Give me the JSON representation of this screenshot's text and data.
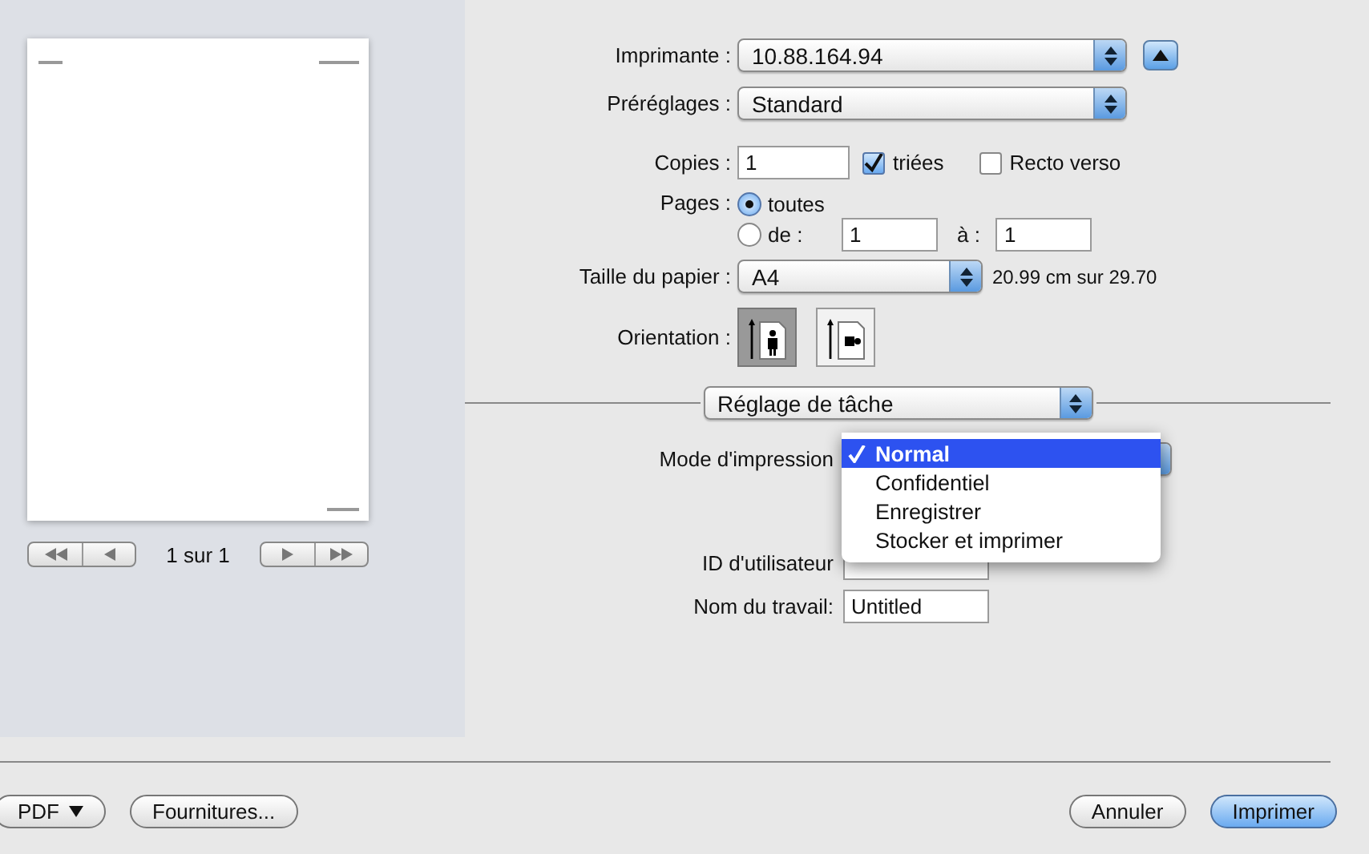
{
  "preview": {
    "page_counter": "1 sur 1"
  },
  "printer": {
    "label": "Imprimante :",
    "value": "10.88.164.94"
  },
  "presets": {
    "label": "Préréglages :",
    "value": "Standard"
  },
  "copies": {
    "label": "Copies :",
    "value": "1"
  },
  "collated": {
    "label": "triées",
    "checked": true
  },
  "duplex": {
    "label": "Recto verso",
    "checked": false
  },
  "pages": {
    "label": "Pages :",
    "options": [
      {
        "label": "toutes",
        "selected": true
      },
      {
        "label": "de :",
        "selected": false
      }
    ],
    "from": "1",
    "to_label": "à :",
    "to": "1"
  },
  "paper": {
    "label": "Taille du papier :",
    "value": "A4",
    "dimensions": "20.99 cm sur 29.70"
  },
  "orientation": {
    "label": "Orientation :",
    "options": [
      {
        "kind": "portrait",
        "selected": true
      },
      {
        "kind": "landscape",
        "selected": false
      }
    ]
  },
  "section": {
    "value": "Réglage de tâche"
  },
  "print_mode": {
    "label": "Mode d'impression",
    "menu": [
      {
        "label": "Normal",
        "selected": true
      },
      {
        "label": "Confidentiel",
        "selected": false
      },
      {
        "label": "Enregistrer",
        "selected": false
      },
      {
        "label": "Stocker et imprimer",
        "selected": false
      }
    ]
  },
  "user_id": {
    "label": "ID d'utilisateur"
  },
  "job_name": {
    "label": "Nom du travail:",
    "value": "Untitled"
  },
  "footer": {
    "pdf": "PDF",
    "supplies": "Fournitures...",
    "cancel": "Annuler",
    "print": "Imprimer"
  }
}
